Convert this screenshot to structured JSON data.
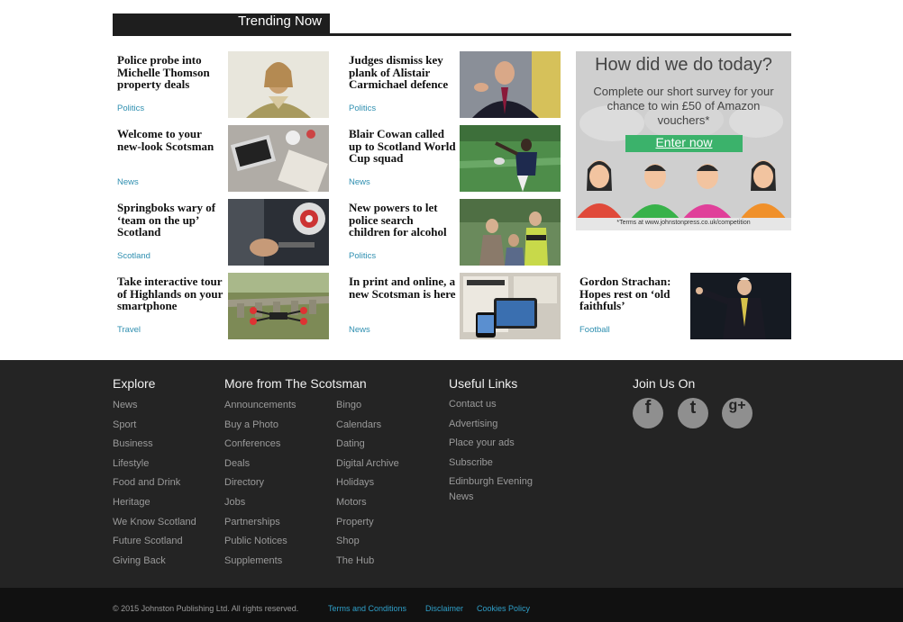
{
  "trending": {
    "title": "Trending Now",
    "stories": [
      {
        "headline": "Police probe into Michelle Thomson property deals",
        "category": "Politics",
        "thumb": "portrait-icon"
      },
      {
        "headline": "Judges dismiss key plank of Alistair Carmichael defence",
        "category": "Politics",
        "thumb": "portrait-icon"
      },
      {
        "headline": "Welcome to your new-look Scotsman",
        "category": "News",
        "thumb": "desk-icon"
      },
      {
        "headline": "Blair Cowan called up to Scotland World Cup squad",
        "category": "News",
        "thumb": "rugby-icon"
      },
      {
        "headline": "Springboks wary of ‘team on the up’ Scotland",
        "category": "Scotland",
        "thumb": "gym-icon"
      },
      {
        "headline": "New powers to let police search children for alcohol",
        "category": "Politics",
        "thumb": "police-icon"
      },
      {
        "headline": "Take interactive tour of Highlands on your smartphone",
        "category": "Travel",
        "thumb": "drone-icon"
      },
      {
        "headline": "In print and online, a new Scotsman is here",
        "category": "News",
        "thumb": "newspaper-icon"
      },
      {
        "headline": "Gordon Strachan: Hopes rest on ‘old faithfuls’",
        "category": "Football",
        "thumb": "manager-icon"
      }
    ]
  },
  "ad": {
    "heading": "How did we do today?",
    "body": "Complete our short survey for your chance to win £50 of Amazon vouchers*",
    "cta": "Enter now",
    "terms": "*Terms at www.johnstonpress.co.uk/competition",
    "colors": {
      "background": "#cfcfcf",
      "cta": "#3bb26b"
    }
  },
  "footer": {
    "explore": {
      "heading": "Explore",
      "links": [
        "News",
        "Sport",
        "Business",
        "Lifestyle",
        "Food and Drink",
        "Heritage",
        "We Know Scotland",
        "Future Scotland",
        "Giving Back"
      ]
    },
    "more": {
      "heading": "More from The Scotsman",
      "col1": [
        "Announcements",
        "Buy a Photo",
        "Conferences",
        "Deals",
        "Directory",
        "Jobs",
        "Partnerships",
        "Public Notices",
        "Supplements"
      ],
      "col2": [
        "Bingo",
        "Calendars",
        "Dating",
        "Digital Archive",
        "Holidays",
        "Motors",
        "Property",
        "Shop",
        "The Hub"
      ]
    },
    "useful": {
      "heading": "Useful Links",
      "links": [
        "Contact us",
        "Advertising",
        "Place your ads",
        "Subscribe",
        "Edinburgh Evening News"
      ]
    },
    "join": {
      "heading": "Join Us On",
      "icons": [
        "facebook-icon",
        "twitter-icon",
        "google-plus-icon"
      ],
      "glyphs": [
        "f",
        "t",
        "g+"
      ]
    }
  },
  "bottom": {
    "copyright": "© 2015 Johnston Publishing Ltd. All rights reserved.",
    "links": [
      "Terms and Conditions",
      "Disclaimer",
      "Cookies Policy"
    ],
    "link_color": "#2f9fc8"
  }
}
